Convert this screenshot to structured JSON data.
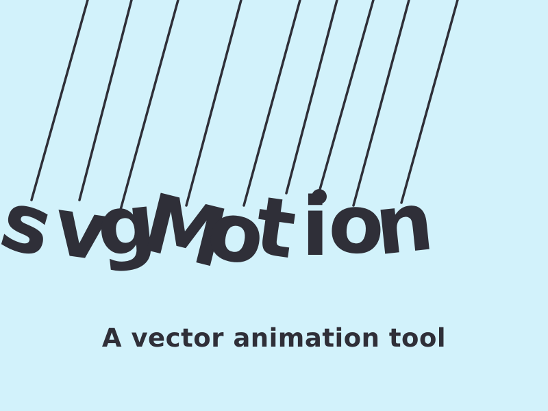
{
  "colors": {
    "background": "#d2f2fb",
    "ink": "#2f2f38"
  },
  "logo": {
    "letters": [
      "s",
      "v",
      "g",
      "M",
      "o",
      "t",
      "i",
      "o",
      "n"
    ]
  },
  "tagline": "A vector animation tool"
}
